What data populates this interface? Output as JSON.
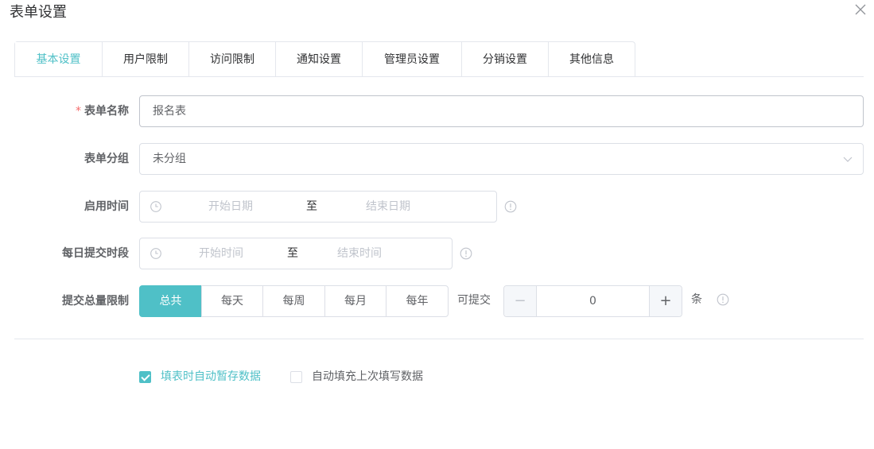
{
  "dialog": {
    "title": "表单设置"
  },
  "tabs": [
    {
      "label": "基本设置",
      "active": true
    },
    {
      "label": "用户限制"
    },
    {
      "label": "访问限制"
    },
    {
      "label": "通知设置"
    },
    {
      "label": "管理员设置"
    },
    {
      "label": "分销设置"
    },
    {
      "label": "其他信息"
    }
  ],
  "form": {
    "name": {
      "required_mark": "*",
      "label": "表单名称",
      "value": "报名表"
    },
    "group": {
      "label": "表单分组",
      "value": "未分组"
    },
    "enable_time": {
      "label": "启用时间",
      "start_placeholder": "开始日期",
      "separator": "至",
      "end_placeholder": "结束日期"
    },
    "daily_period": {
      "label": "每日提交时段",
      "start_placeholder": "开始时间",
      "separator": "至",
      "end_placeholder": "结束时间"
    },
    "submit_limit": {
      "label": "提交总量限制",
      "options": [
        "总共",
        "每天",
        "每周",
        "每月",
        "每年"
      ],
      "selected": "总共",
      "prefix": "可提交",
      "count": "0",
      "unit": "条"
    }
  },
  "options": {
    "autosave": {
      "label": "填表时自动暂存数据",
      "checked": true
    },
    "autofill": {
      "label": "自动填充上次填写数据",
      "checked": false
    }
  },
  "colors": {
    "accent": "#4fc0c7",
    "required": "#f56c6c",
    "border": "#dcdfe6"
  },
  "icons": {
    "close": "close-icon",
    "clock": "clock-icon",
    "info": "info-icon",
    "chevron": "chevron-down-icon"
  }
}
